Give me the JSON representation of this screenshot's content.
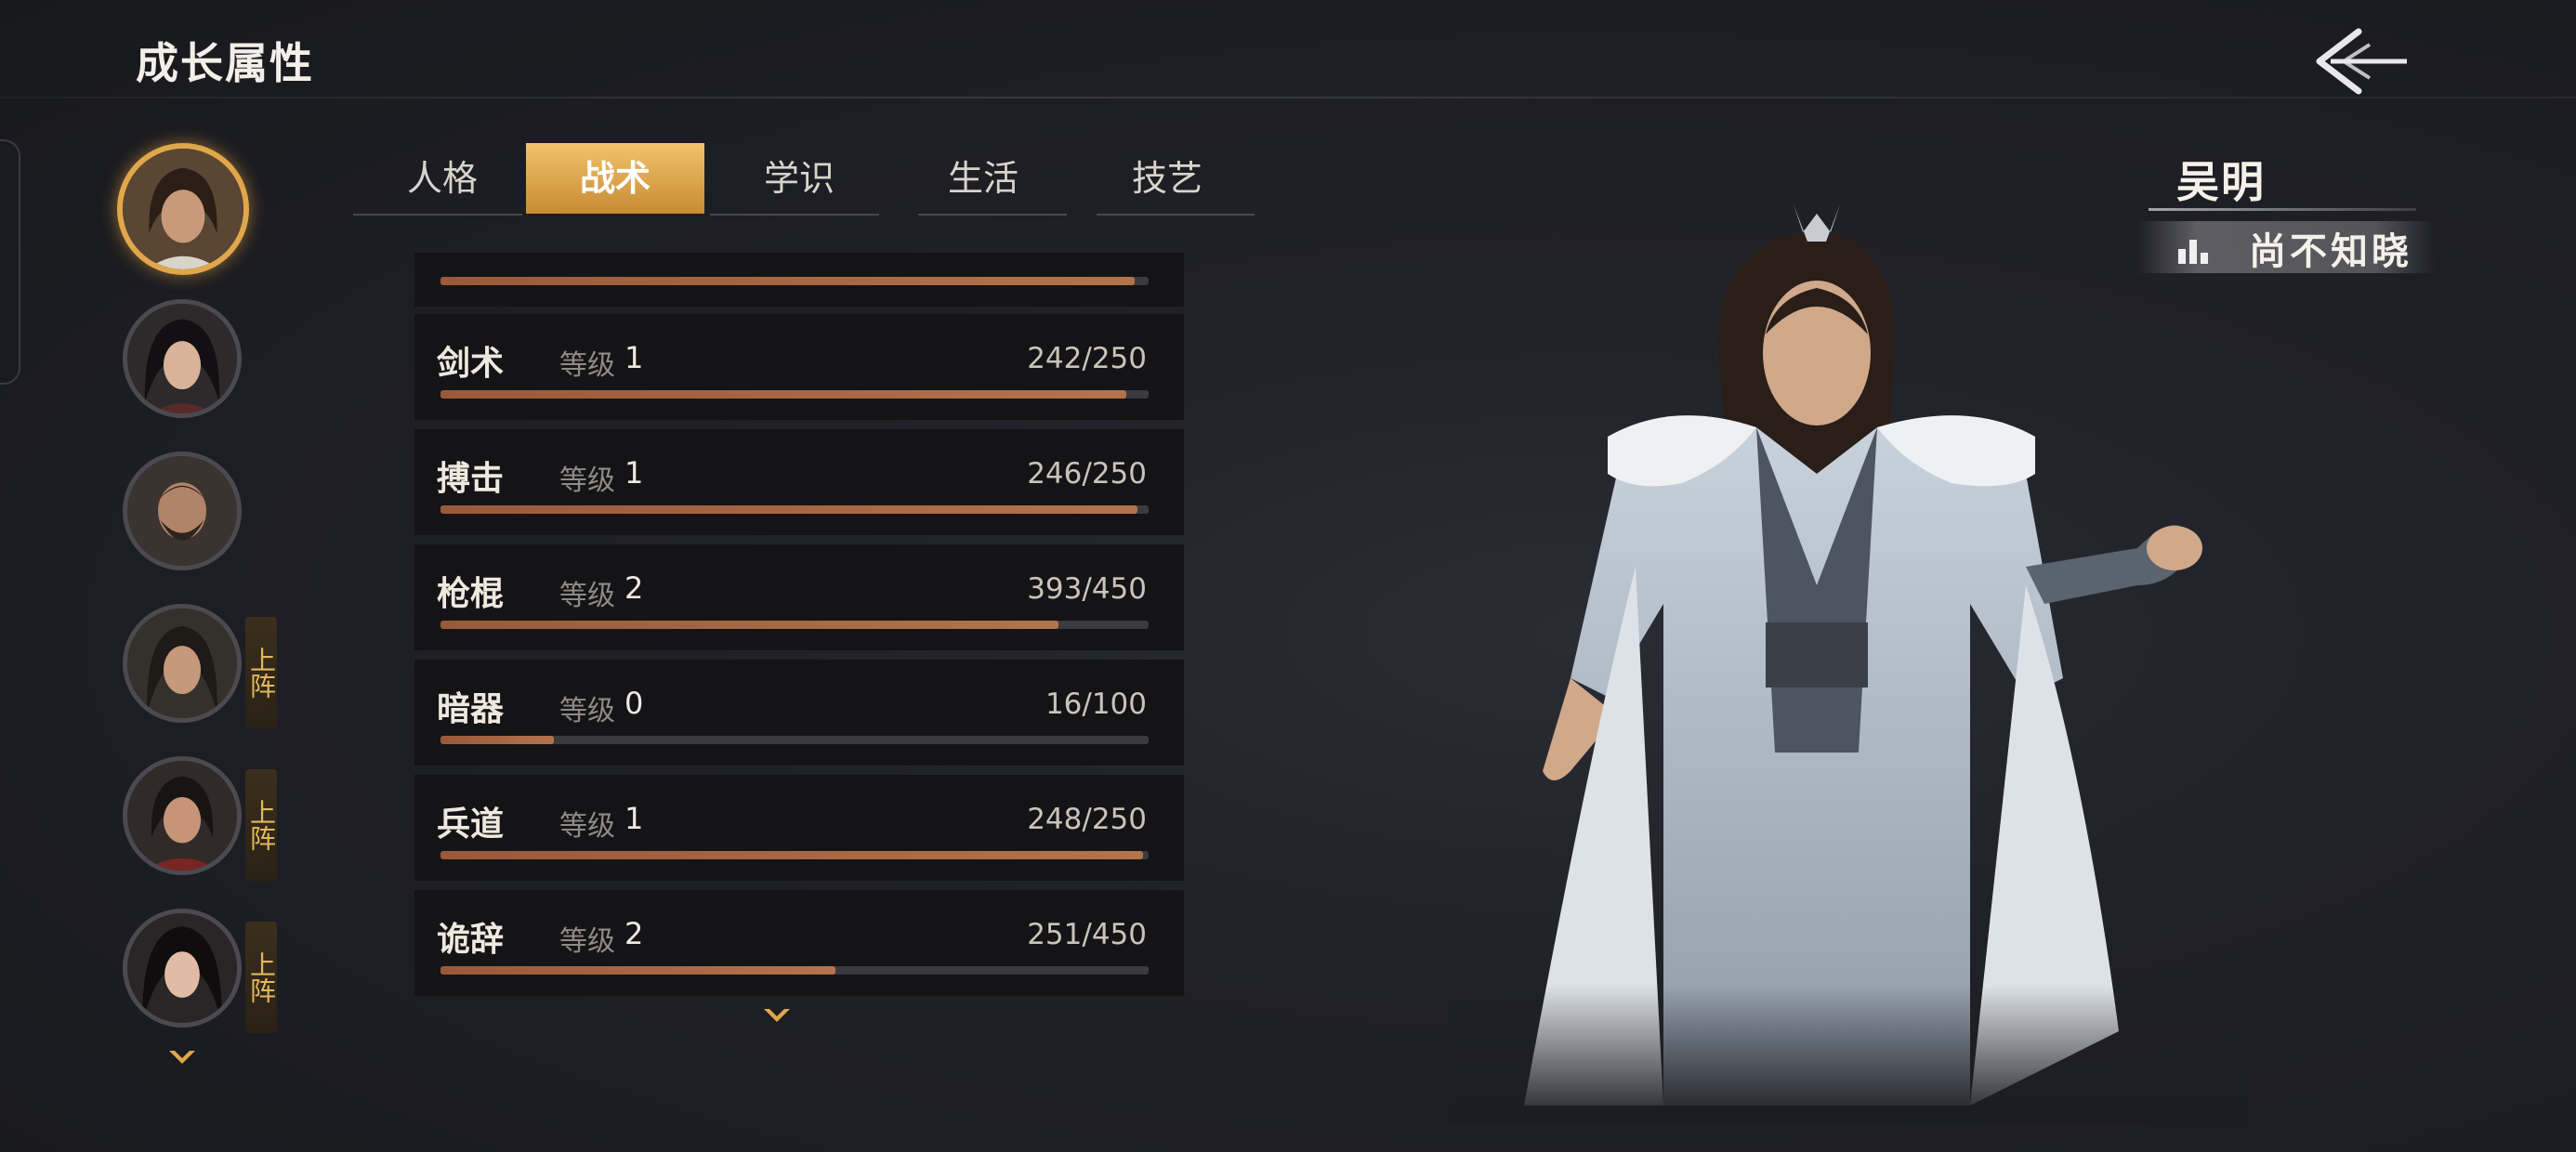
{
  "header": {
    "title": "成长属性"
  },
  "tabs": [
    {
      "label": "人格"
    },
    {
      "label": "战术"
    },
    {
      "label": "学识"
    },
    {
      "label": "生活"
    },
    {
      "label": "技艺"
    }
  ],
  "active_tab": "战术",
  "level_label": "等级",
  "skills": [
    {
      "name": "",
      "level": "",
      "xp": "",
      "progress": 0.98
    },
    {
      "name": "剑术",
      "level": "1",
      "xp": "242/250",
      "progress": 0.968
    },
    {
      "name": "搏击",
      "level": "1",
      "xp": "246/250",
      "progress": 0.984
    },
    {
      "name": "枪棍",
      "level": "2",
      "xp": "393/450",
      "progress": 0.873
    },
    {
      "name": "暗器",
      "level": "0",
      "xp": "16/100",
      "progress": 0.16
    },
    {
      "name": "兵道",
      "level": "1",
      "xp": "248/250",
      "progress": 0.992
    },
    {
      "name": "诡辞",
      "level": "2",
      "xp": "251/450",
      "progress": 0.558
    }
  ],
  "roster": {
    "deploy_label": "上阵",
    "members": [
      {
        "icon": "portrait-young-man",
        "active": true,
        "deployed": false
      },
      {
        "icon": "portrait-woman",
        "active": false,
        "deployed": false
      },
      {
        "icon": "portrait-bearded-man",
        "active": false,
        "deployed": false
      },
      {
        "icon": "portrait-man-long-hair",
        "active": false,
        "deployed": true
      },
      {
        "icon": "portrait-man-red-robe",
        "active": false,
        "deployed": true
      },
      {
        "icon": "portrait-woman-dark-hair",
        "active": false,
        "deployed": true
      }
    ]
  },
  "character": {
    "name": "吴明",
    "title": "尚不知晓"
  },
  "colors": {
    "accent": "#e0a74a",
    "bar_fill": "#a8653f",
    "background": "#1c1d22"
  }
}
